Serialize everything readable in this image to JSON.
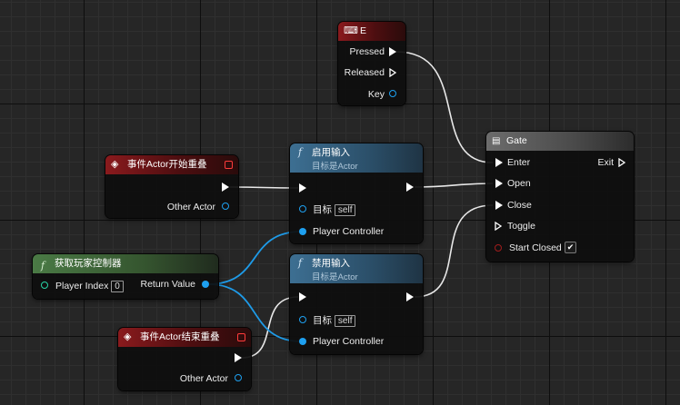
{
  "nodes": {
    "key_e": {
      "title": "E",
      "icon": "keyboard-icon",
      "pins": {
        "pressed": "Pressed",
        "released": "Released",
        "key": "Key"
      }
    },
    "begin_overlap": {
      "title": "事件Actor开始重叠",
      "icon": "event-diamond-icon",
      "pins": {
        "other_actor": "Other Actor"
      }
    },
    "enable_input": {
      "title": "启用输入",
      "subtitle": "目标是Actor",
      "icon": "function-icon",
      "pins": {
        "target": "目标",
        "self": "self",
        "player_controller": "Player Controller"
      }
    },
    "get_player_controller": {
      "title": "获取玩家控制器",
      "icon": "function-icon",
      "pins": {
        "player_index": "Player Index",
        "player_index_value": "0",
        "return_value": "Return Value"
      }
    },
    "disable_input": {
      "title": "禁用输入",
      "subtitle": "目标是Actor",
      "icon": "function-icon",
      "pins": {
        "target": "目标",
        "self": "self",
        "player_controller": "Player Controller"
      }
    },
    "end_overlap": {
      "title": "事件Actor结束重叠",
      "icon": "event-diamond-icon",
      "pins": {
        "other_actor": "Other Actor"
      }
    },
    "gate": {
      "title": "Gate",
      "icon": "gate-icon",
      "pins": {
        "enter": "Enter",
        "exit": "Exit",
        "open": "Open",
        "close": "Close",
        "toggle": "Toggle",
        "start_closed": "Start Closed"
      },
      "start_closed_checked": true
    }
  },
  "colors": {
    "exec": "#ffffff",
    "object_pin": "#1ea0f0",
    "bool_pin": "#a01c1c",
    "event_header": "#8a1a1d",
    "function_header": "#3d6f92",
    "pure_function_header": "#4a7a45",
    "macro_header": "#6c6c6c"
  }
}
